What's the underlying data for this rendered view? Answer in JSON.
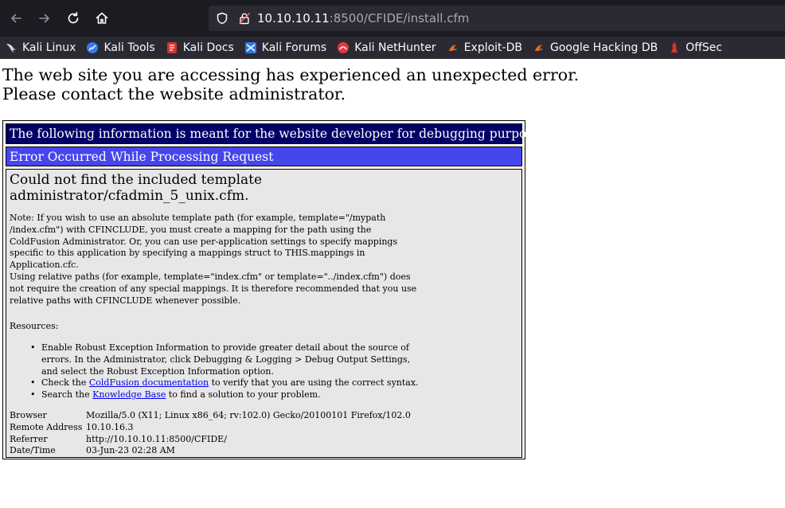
{
  "browser": {
    "url_host": "10.10.10.11",
    "url_rest": ":8500/CFIDE/install.cfm",
    "bookmarks": [
      {
        "label": "Kali Linux",
        "icon": "kali-dragon-icon"
      },
      {
        "label": "Kali Tools",
        "icon": "kali-tools-icon"
      },
      {
        "label": "Kali Docs",
        "icon": "kali-docs-icon"
      },
      {
        "label": "Kali Forums",
        "icon": "kali-forums-icon"
      },
      {
        "label": "Kali NetHunter",
        "icon": "kali-nethunter-icon"
      },
      {
        "label": "Exploit-DB",
        "icon": "exploit-db-icon"
      },
      {
        "label": "Google Hacking DB",
        "icon": "ghdb-icon"
      },
      {
        "label": "OffSec",
        "icon": "offsec-icon"
      }
    ],
    "colors": {
      "chrome": "#1c1b22",
      "urlbar": "#2b2a33",
      "text": "#fbfbfe"
    }
  },
  "page": {
    "error_line1": "The web site you are accessing has experienced an unexpected error.",
    "error_line2": "Please contact the website administrator.",
    "dev_notice": "The following information is meant for the website developer for debugging purposes.",
    "request_error": "Error Occurred While Processing Request",
    "detail_title_line1": "Could not find the included template",
    "detail_title_line2": "administrator/cfadmin_5_unix.cfm.",
    "note_lines": [
      "Note: If you wish to use an absolute template path (for example, template=\"/mypath",
      "/index.cfm\") with CFINCLUDE, you must create a mapping for the path using the",
      "ColdFusion Administrator. Or, you can use per-application settings to specify mappings",
      "specific to this application by specifying a mappings struct to THIS.mappings in",
      "Application.cfc.",
      "Using relative paths (for example, template=\"index.cfm\" or template=\"../index.cfm\") does",
      "not require the creation of any special mappings. It is therefore recommended that you use",
      "relative paths with CFINCLUDE whenever possible."
    ],
    "resources_label": "Resources:",
    "resources": {
      "item1_lines": [
        "Enable Robust Exception Information to provide greater detail about the source of",
        "errors. In the Administrator, click Debugging & Logging > Debug Output Settings,",
        "and select the Robust Exception Information option."
      ],
      "item2_pre": "Check the ",
      "item2_link": "ColdFusion documentation",
      "item2_post": " to verify that you are using the correct syntax.",
      "item3_pre": "Search the ",
      "item3_link": "Knowledge Base",
      "item3_post": " to find a solution to your problem."
    },
    "meta": [
      {
        "key": "Browser",
        "value": "Mozilla/5.0 (X11; Linux x86_64; rv:102.0) Gecko/20100101 Firefox/102.0"
      },
      {
        "key": "Remote Address",
        "value": "10.10.16.3"
      },
      {
        "key": "Referrer",
        "value": "http://10.10.10.11:8500/CFIDE/"
      },
      {
        "key": "Date/Time",
        "value": "03-Jun-23 02:28 AM"
      }
    ],
    "colors": {
      "dev_bar": "#000066",
      "request_bar": "#4646ee",
      "detail_bg": "#e7e7e7",
      "link": "#0000ee"
    }
  }
}
